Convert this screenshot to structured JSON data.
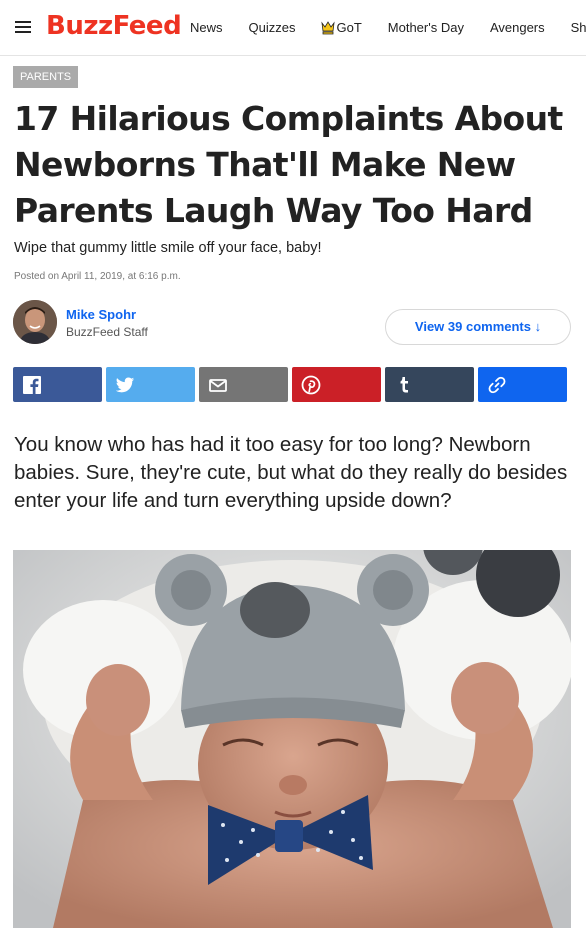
{
  "nav": {
    "logo": "BuzzFeed",
    "links": [
      {
        "label": "News"
      },
      {
        "label": "Quizzes"
      },
      {
        "label": "GoT",
        "icon": "got-crown-icon"
      },
      {
        "label": "Mother's Day"
      },
      {
        "label": "Avengers"
      },
      {
        "label": "Sho"
      }
    ]
  },
  "article": {
    "category": "PARENTS",
    "title": "17 Hilarious Complaints About Newborns That'll Make New Parents Laugh Way Too Hard",
    "dek": "Wipe that gummy little smile off your face, baby!",
    "posted": "Posted on April 11, 2019, at 6:16 p.m.",
    "lede": "You know who has had it too easy for too long? Newborn babies. Sure, they're cute, but what do they really do besides enter your life and turn everything upside down?"
  },
  "author": {
    "name": "Mike Spohr",
    "role": "BuzzFeed Staff"
  },
  "comments": {
    "label": "View 39 comments ↓"
  },
  "share": [
    {
      "network": "facebook",
      "icon": "facebook-icon",
      "color": "#3b5998"
    },
    {
      "network": "twitter",
      "icon": "twitter-icon",
      "color": "#55acee"
    },
    {
      "network": "email",
      "icon": "email-icon",
      "color": "#757575"
    },
    {
      "network": "pinterest",
      "icon": "pinterest-icon",
      "color": "#cb2027"
    },
    {
      "network": "tumblr",
      "icon": "tumblr-icon",
      "color": "#35465c"
    },
    {
      "network": "link",
      "icon": "link-icon",
      "color": "#0f65ef"
    }
  ],
  "colors": {
    "brand": "#ee3322",
    "link": "#0f65ef",
    "badge": "#aaaaaa"
  }
}
